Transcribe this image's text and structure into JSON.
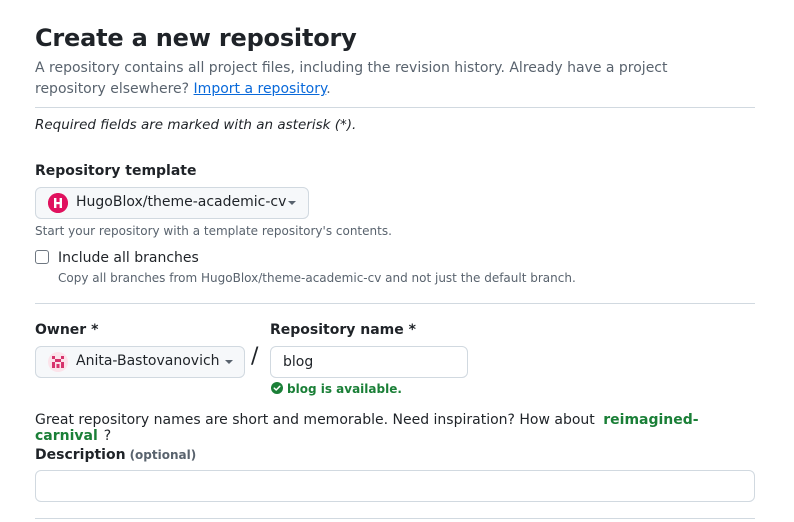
{
  "header": {
    "title": "Create a new repository",
    "intro_text": "A repository contains all project files, including the revision history. Already have a project repository elsewhere?",
    "import_link": "Import a repository",
    "intro_end": "."
  },
  "required_note": "Required fields are marked with an asterisk (*).",
  "template": {
    "label": "Repository template",
    "selected": "HugoBlox/theme-academic-cv",
    "hint": "Start your repository with a template repository's contents.",
    "include_branches_label": "Include all branches",
    "include_branches_hint": "Copy all branches from HugoBlox/theme-academic-cv and not just the default branch.",
    "include_branches_checked": false
  },
  "owner": {
    "label": "Owner *",
    "selected": "Anita-Bastovanovich"
  },
  "separator": "/",
  "repo_name": {
    "label": "Repository name *",
    "value": "blog",
    "availability": "blog is available."
  },
  "inspiration": {
    "text": "Great repository names are short and memorable. Need inspiration? How about",
    "suggestion": "reimagined-carnival",
    "end": "?"
  },
  "description": {
    "label": "Description",
    "optional": "(optional)",
    "value": ""
  },
  "colors": {
    "link": "#0969da",
    "success": "#1a7f37",
    "muted": "#59636e",
    "border": "#d1d9e0"
  }
}
